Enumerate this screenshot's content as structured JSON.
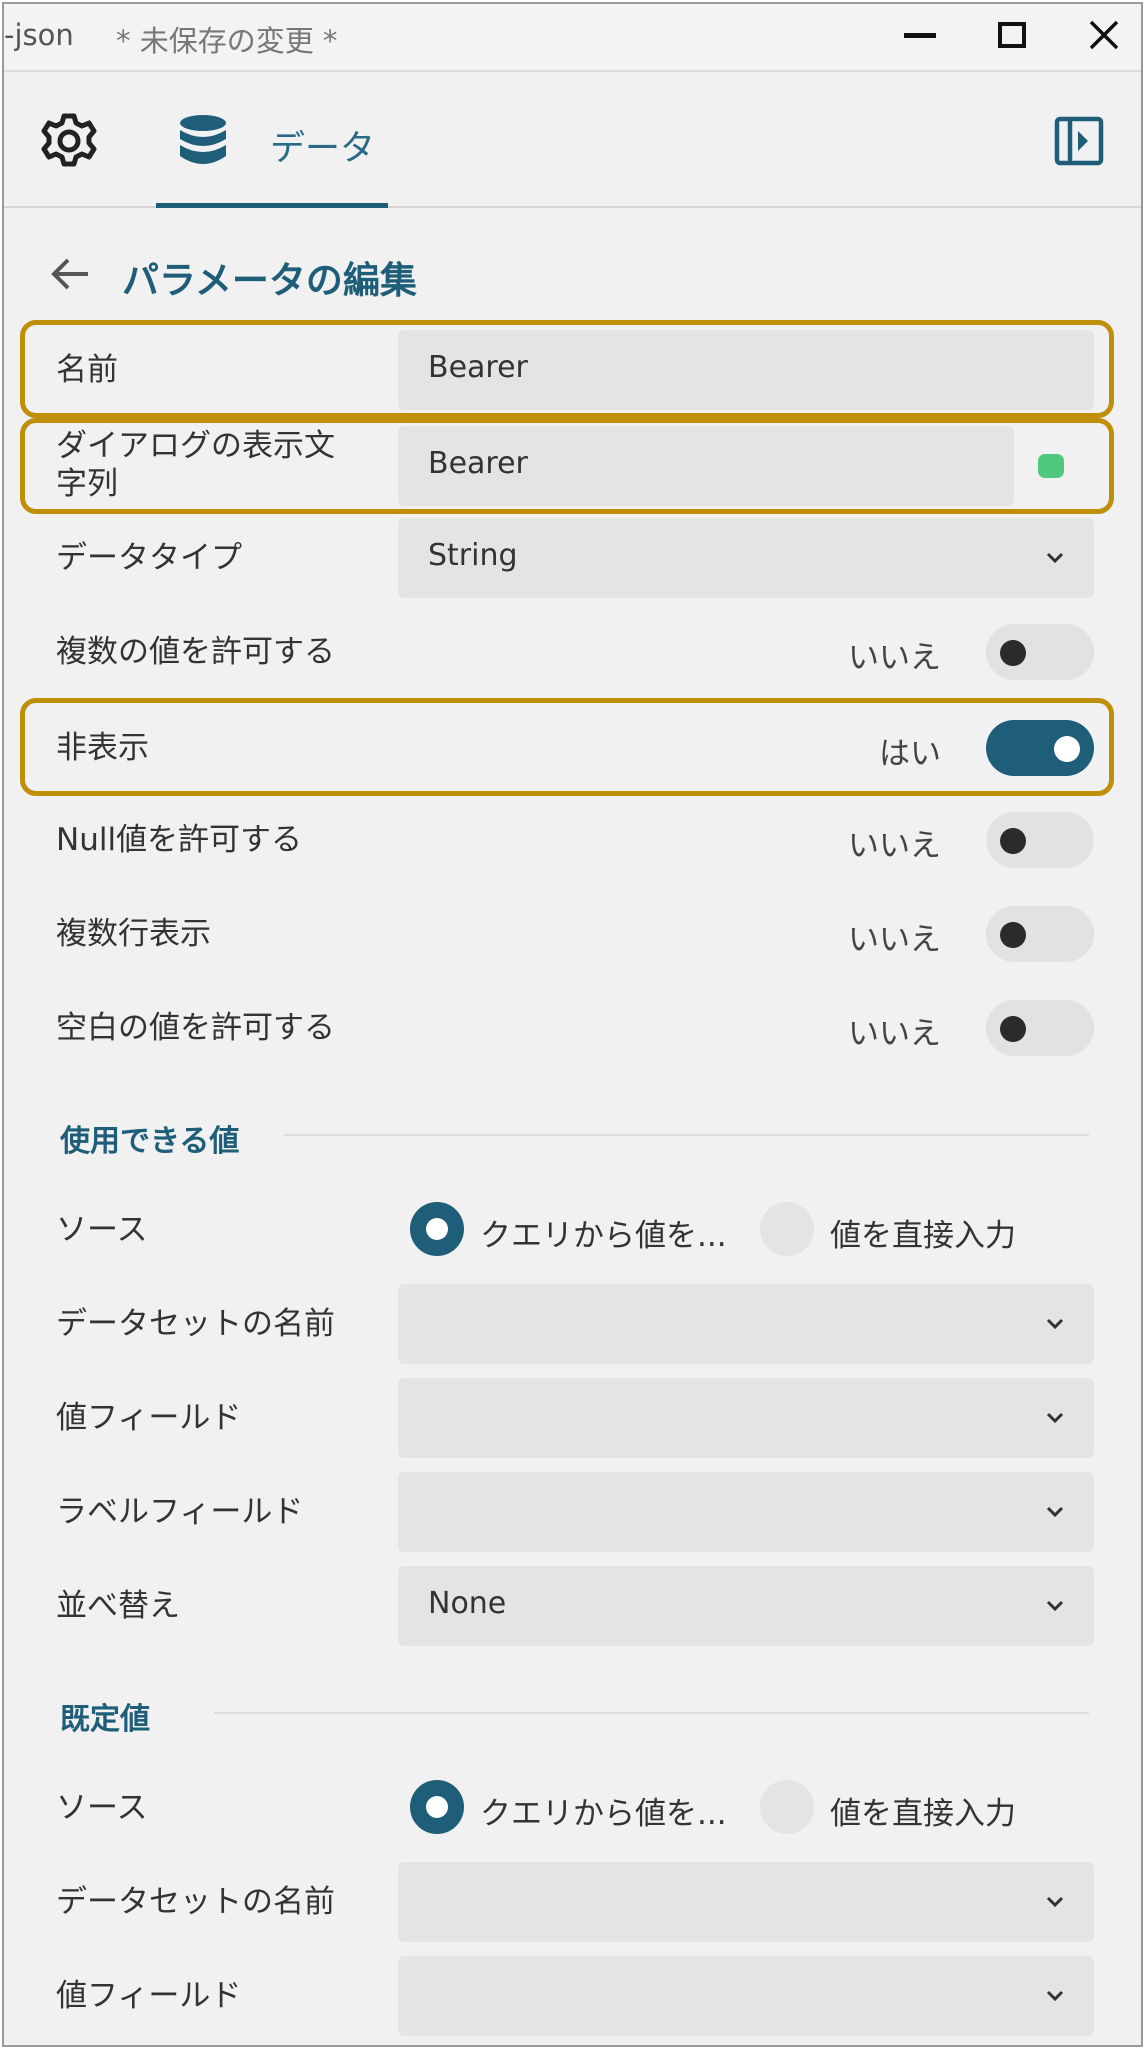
{
  "window": {
    "title": "-json",
    "unsaved": "* 未保存の変更 *"
  },
  "tabs": {
    "data_label": "データ"
  },
  "header": {
    "title": "パラメータの編集"
  },
  "form": {
    "name_label": "名前",
    "name_value": "Bearer",
    "display_label_line1": "ダイアログの表示文",
    "display_label_line2": "字列",
    "display_value": "Bearer",
    "datatype_label": "データタイプ",
    "datatype_value": "String",
    "multi_label": "複数の値を許可する",
    "multi_state": "いいえ",
    "hidden_label": "非表示",
    "hidden_state": "はい",
    "null_label": "Null値を許可する",
    "null_state": "いいえ",
    "multiline_label": "複数行表示",
    "multiline_state": "いいえ",
    "blank_label": "空白の値を許可する",
    "blank_state": "いいえ"
  },
  "available": {
    "section_title": "使用できる値",
    "source_label": "ソース",
    "opt_query": "クエリから値を...",
    "opt_direct": "値を直接入力",
    "dataset_label": "データセットの名前",
    "value_field_label": "値フィールド",
    "label_field_label": "ラベルフィールド",
    "sort_label": "並べ替え",
    "sort_value": "None"
  },
  "defaults": {
    "section_title": "既定値",
    "source_label": "ソース",
    "opt_query": "クエリから値を...",
    "opt_direct": "値を直接入力",
    "dataset_label": "データセットの名前",
    "value_field_label": "値フィールド"
  },
  "colors": {
    "accent": "#1f5e78",
    "highlight": "#bf8f0a",
    "status_ok": "#4fc97d"
  }
}
